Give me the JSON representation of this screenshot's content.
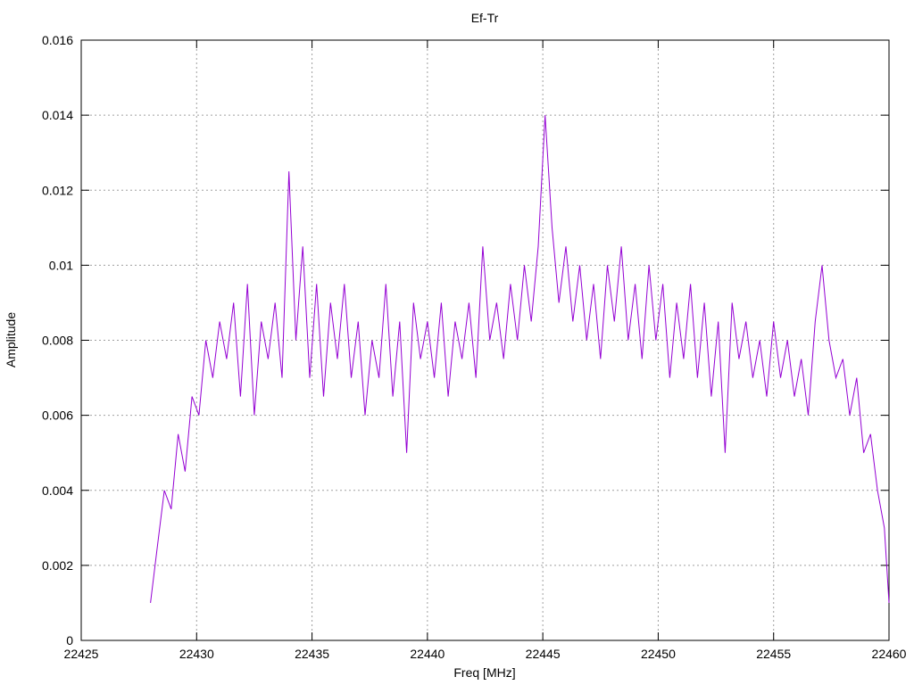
{
  "chart_data": {
    "type": "line",
    "title": "Ef-Tr",
    "xlabel": "Freq [MHz]",
    "ylabel": "Amplitude",
    "xlim": [
      22425,
      22460
    ],
    "ylim": [
      0,
      0.016
    ],
    "x_ticks": [
      22425,
      22430,
      22435,
      22440,
      22445,
      22450,
      22455,
      22460
    ],
    "y_ticks": [
      0,
      0.002,
      0.004,
      0.006,
      0.008,
      0.01,
      0.012,
      0.014,
      0.016
    ],
    "y_tick_labels": [
      "0",
      "0.002",
      "0.004",
      "0.006",
      "0.008",
      "0.01",
      "0.012",
      "0.014",
      "0.016"
    ],
    "x_tick_labels": [
      "22425",
      "22430",
      "22435",
      "22440",
      "22445",
      "22450",
      "22455",
      "22460"
    ],
    "grid": true,
    "legend": "none",
    "series": [
      {
        "color": "#9400d3",
        "x": [
          22428.0,
          22428.3,
          22428.6,
          22428.9,
          22429.2,
          22429.5,
          22429.8,
          22430.1,
          22430.4,
          22430.7,
          22431.0,
          22431.3,
          22431.6,
          22431.9,
          22432.2,
          22432.5,
          22432.8,
          22433.1,
          22433.4,
          22433.7,
          22434.0,
          22434.3,
          22434.6,
          22434.9,
          22435.2,
          22435.5,
          22435.8,
          22436.1,
          22436.4,
          22436.7,
          22437.0,
          22437.3,
          22437.6,
          22437.9,
          22438.2,
          22438.5,
          22438.8,
          22439.1,
          22439.4,
          22439.7,
          22440.0,
          22440.3,
          22440.6,
          22440.9,
          22441.2,
          22441.5,
          22441.8,
          22442.1,
          22442.4,
          22442.7,
          22443.0,
          22443.3,
          22443.6,
          22443.9,
          22444.2,
          22444.5,
          22444.8,
          22445.1,
          22445.4,
          22445.7,
          22446.0,
          22446.3,
          22446.6,
          22446.9,
          22447.2,
          22447.5,
          22447.8,
          22448.1,
          22448.4,
          22448.7,
          22449.0,
          22449.3,
          22449.6,
          22449.9,
          22450.2,
          22450.5,
          22450.8,
          22451.1,
          22451.4,
          22451.7,
          22452.0,
          22452.3,
          22452.6,
          22452.9,
          22453.2,
          22453.5,
          22453.8,
          22454.1,
          22454.4,
          22454.7,
          22455.0,
          22455.3,
          22455.6,
          22455.9,
          22456.2,
          22456.5,
          22456.8,
          22457.1,
          22457.4,
          22457.7,
          22458.0,
          22458.3,
          22458.6,
          22458.9,
          22459.2,
          22459.5,
          22459.8,
          22460.0
        ],
        "y": [
          0.001,
          0.0025,
          0.004,
          0.0035,
          0.0055,
          0.0045,
          0.0065,
          0.006,
          0.008,
          0.007,
          0.0085,
          0.0075,
          0.009,
          0.0065,
          0.0095,
          0.006,
          0.0085,
          0.0075,
          0.009,
          0.007,
          0.0125,
          0.008,
          0.0105,
          0.007,
          0.0095,
          0.0065,
          0.009,
          0.0075,
          0.0095,
          0.007,
          0.0085,
          0.006,
          0.008,
          0.007,
          0.0095,
          0.0065,
          0.0085,
          0.005,
          0.009,
          0.0075,
          0.0085,
          0.007,
          0.009,
          0.0065,
          0.0085,
          0.0075,
          0.009,
          0.007,
          0.0105,
          0.008,
          0.009,
          0.0075,
          0.0095,
          0.008,
          0.01,
          0.0085,
          0.0105,
          0.014,
          0.011,
          0.009,
          0.0105,
          0.0085,
          0.01,
          0.008,
          0.0095,
          0.0075,
          0.01,
          0.0085,
          0.0105,
          0.008,
          0.0095,
          0.0075,
          0.01,
          0.008,
          0.0095,
          0.007,
          0.009,
          0.0075,
          0.0095,
          0.007,
          0.009,
          0.0065,
          0.0085,
          0.005,
          0.009,
          0.0075,
          0.0085,
          0.007,
          0.008,
          0.0065,
          0.0085,
          0.007,
          0.008,
          0.0065,
          0.0075,
          0.006,
          0.0085,
          0.01,
          0.008,
          0.007,
          0.0075,
          0.006,
          0.007,
          0.005,
          0.0055,
          0.004,
          0.003,
          0.001
        ]
      }
    ]
  }
}
